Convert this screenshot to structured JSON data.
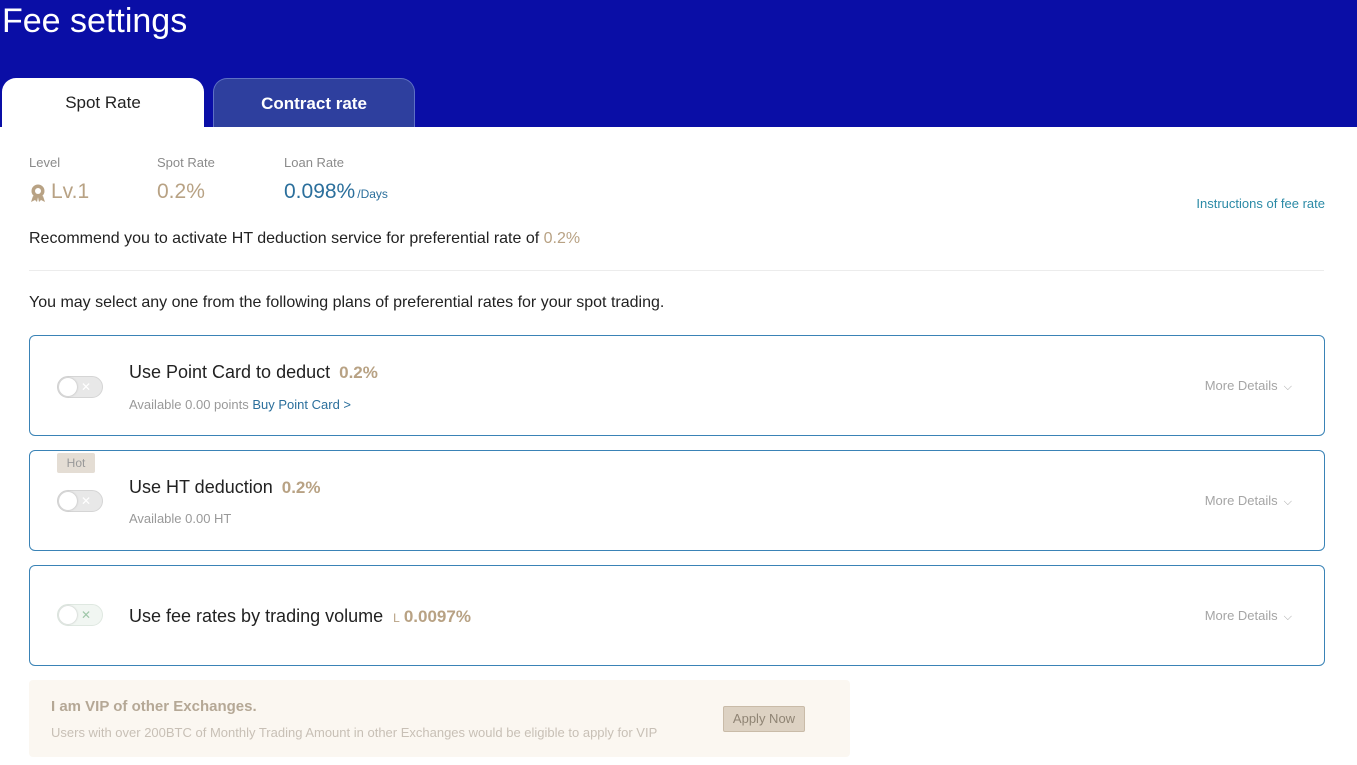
{
  "page": {
    "title": "Fee settings"
  },
  "tabs": [
    {
      "label": "Spot Rate",
      "active": true
    },
    {
      "label": "Contract rate",
      "active": false
    }
  ],
  "summary": {
    "level_label": "Level",
    "level_value": "Lv.1",
    "spot_rate_label": "Spot Rate",
    "spot_rate_value": "0.2%",
    "loan_rate_label": "Loan Rate",
    "loan_rate_value": "0.098%",
    "loan_rate_unit": "/Days",
    "instructions_link": "Instructions of fee rate"
  },
  "recommend": {
    "text": "Recommend you to activate HT deduction service for preferential rate of",
    "rate": "0.2%"
  },
  "intro": "You may select any one from the following plans of preferential rates for your spot trading.",
  "plans": [
    {
      "title": "Use Point Card to deduct",
      "rate": "0.2%",
      "available": "Available 0.00 points",
      "link": "Buy Point Card >",
      "more": "More Details",
      "enabled": false
    },
    {
      "badge": "Hot",
      "title": "Use HT deduction",
      "rate": "0.2%",
      "available": "Available 0.00 HT",
      "more": "More Details",
      "enabled": false
    },
    {
      "title": "Use fee rates by trading volume",
      "prefix": "L",
      "rate": "0.0097%",
      "more": "More Details",
      "enabled": false
    }
  ],
  "vip": {
    "title": "I am VIP of other Exchanges.",
    "description": "Users with over 200BTC of Monthly Trading Amount in other Exchanges would be eligible to apply for VIP",
    "button": "Apply Now"
  },
  "icons": {
    "level": "medal-icon",
    "toggle_off": "close-icon",
    "more": "chevron-down-icon"
  },
  "colors": {
    "header_bg": "#0a0ea6",
    "gold": "#b8a284",
    "blue": "#2b6f9c",
    "plan_border": "#3a83b6"
  }
}
